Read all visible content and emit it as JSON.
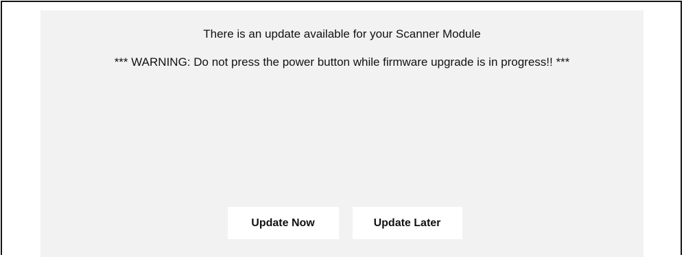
{
  "dialog": {
    "title": "There is an update available for your Scanner Module",
    "warning": "*** WARNING: Do not press the power button while firmware upgrade is in progress!! ***"
  },
  "actions": {
    "update_now_label": "Update Now",
    "update_later_label": "Update Later"
  },
  "colors": {
    "panel_background": "#f2f2f2",
    "button_background": "#ffffff",
    "frame_border": "#111111"
  }
}
